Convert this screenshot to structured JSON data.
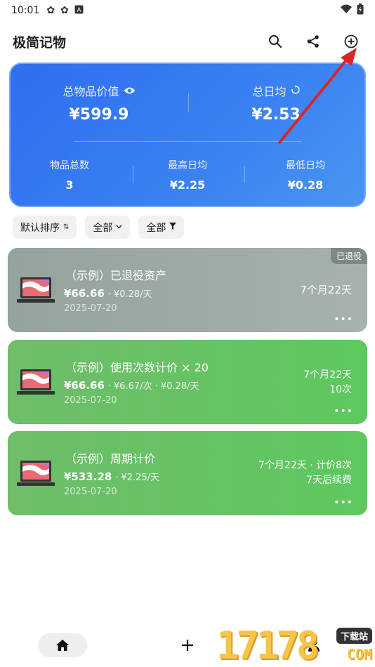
{
  "status_bar": {
    "time": "10:01",
    "icons": [
      "sync-icon",
      "sync-icon",
      "notification-a-icon"
    ],
    "right_icons": [
      "wifi-icon",
      "battery-icon"
    ]
  },
  "app_bar": {
    "title": "极简记物",
    "actions": [
      "search-icon",
      "share-icon",
      "add-circle-icon"
    ]
  },
  "summary": {
    "total_value_label": "总物品价值",
    "total_value": "¥599.9",
    "daily_avg_label": "总日均",
    "daily_avg": "¥2.53",
    "count_label": "物品总数",
    "count": "3",
    "max_daily_label": "最高日均",
    "max_daily": "¥2.25",
    "min_daily_label": "最低日均",
    "min_daily": "¥0.28"
  },
  "filters": [
    {
      "label": "默认排序"
    },
    {
      "label": "全部"
    },
    {
      "label": "全部"
    }
  ],
  "items": [
    {
      "name": "（示例）已退役资产",
      "price": "¥66.66",
      "sub": "· ¥0.28/天",
      "date": "2025-07-20",
      "right_line1": "7个月22天",
      "right_line2": "",
      "badge": "已退役",
      "more": "•••"
    },
    {
      "name": "（示例）使用次数计价 × 20",
      "price": "¥66.66",
      "sub": "· ¥6.67/次 · ¥0.28/天",
      "date": "2025-07-20",
      "right_line1": "7个月22天",
      "right_line2": "10次",
      "badge": "",
      "more": "•••"
    },
    {
      "name": "（示例）周期计价",
      "price": "¥533.28",
      "sub": "· ¥2.25/天",
      "date": "2025-07-20",
      "right_line1": "7个月22天 · 计价8次",
      "right_line2": "7天后续费",
      "badge": "",
      "more": "•••"
    }
  ],
  "bottom_nav": {
    "home": "home-icon",
    "add": "+",
    "profile": "person-icon"
  },
  "watermark": {
    "number": "17178",
    "tag": "下载站",
    "domain": "COM"
  },
  "colors": {
    "summary_blue": "#3478f2",
    "retired_gray": "#9aa8a1",
    "active_green": "#62c463",
    "annotation_red": "#d8262b"
  }
}
